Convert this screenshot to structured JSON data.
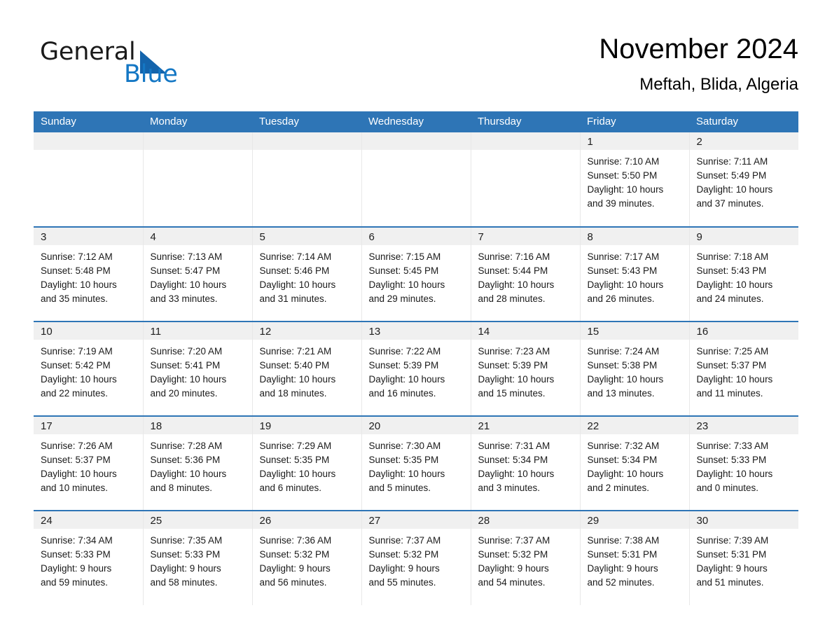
{
  "brand": {
    "line1": "General",
    "line2": "Blue",
    "triangle_color": "#1464ac",
    "blue_text_color": "#1477c4"
  },
  "header": {
    "title": "November 2024",
    "subtitle": "Meftah, Blida, Algeria"
  },
  "theme": {
    "header_blue": "#2e75b6",
    "daynum_bg": "#f0f0f0",
    "page_bg": "#ffffff"
  },
  "weekdays": [
    "Sunday",
    "Monday",
    "Tuesday",
    "Wednesday",
    "Thursday",
    "Friday",
    "Saturday"
  ],
  "weeks": [
    [
      {
        "day": "",
        "blank": true,
        "lines": [
          "",
          "",
          "",
          ""
        ]
      },
      {
        "day": "",
        "blank": true,
        "lines": [
          "",
          "",
          "",
          ""
        ]
      },
      {
        "day": "",
        "blank": true,
        "lines": [
          "",
          "",
          "",
          ""
        ]
      },
      {
        "day": "",
        "blank": true,
        "lines": [
          "",
          "",
          "",
          ""
        ]
      },
      {
        "day": "",
        "blank": true,
        "lines": [
          "",
          "",
          "",
          ""
        ]
      },
      {
        "day": "1",
        "blank": false,
        "lines": [
          "Sunrise: 7:10 AM",
          "Sunset: 5:50 PM",
          "Daylight: 10 hours",
          "and 39 minutes."
        ]
      },
      {
        "day": "2",
        "blank": false,
        "lines": [
          "Sunrise: 7:11 AM",
          "Sunset: 5:49 PM",
          "Daylight: 10 hours",
          "and 37 minutes."
        ]
      }
    ],
    [
      {
        "day": "3",
        "blank": false,
        "lines": [
          "Sunrise: 7:12 AM",
          "Sunset: 5:48 PM",
          "Daylight: 10 hours",
          "and 35 minutes."
        ]
      },
      {
        "day": "4",
        "blank": false,
        "lines": [
          "Sunrise: 7:13 AM",
          "Sunset: 5:47 PM",
          "Daylight: 10 hours",
          "and 33 minutes."
        ]
      },
      {
        "day": "5",
        "blank": false,
        "lines": [
          "Sunrise: 7:14 AM",
          "Sunset: 5:46 PM",
          "Daylight: 10 hours",
          "and 31 minutes."
        ]
      },
      {
        "day": "6",
        "blank": false,
        "lines": [
          "Sunrise: 7:15 AM",
          "Sunset: 5:45 PM",
          "Daylight: 10 hours",
          "and 29 minutes."
        ]
      },
      {
        "day": "7",
        "blank": false,
        "lines": [
          "Sunrise: 7:16 AM",
          "Sunset: 5:44 PM",
          "Daylight: 10 hours",
          "and 28 minutes."
        ]
      },
      {
        "day": "8",
        "blank": false,
        "lines": [
          "Sunrise: 7:17 AM",
          "Sunset: 5:43 PM",
          "Daylight: 10 hours",
          "and 26 minutes."
        ]
      },
      {
        "day": "9",
        "blank": false,
        "lines": [
          "Sunrise: 7:18 AM",
          "Sunset: 5:43 PM",
          "Daylight: 10 hours",
          "and 24 minutes."
        ]
      }
    ],
    [
      {
        "day": "10",
        "blank": false,
        "lines": [
          "Sunrise: 7:19 AM",
          "Sunset: 5:42 PM",
          "Daylight: 10 hours",
          "and 22 minutes."
        ]
      },
      {
        "day": "11",
        "blank": false,
        "lines": [
          "Sunrise: 7:20 AM",
          "Sunset: 5:41 PM",
          "Daylight: 10 hours",
          "and 20 minutes."
        ]
      },
      {
        "day": "12",
        "blank": false,
        "lines": [
          "Sunrise: 7:21 AM",
          "Sunset: 5:40 PM",
          "Daylight: 10 hours",
          "and 18 minutes."
        ]
      },
      {
        "day": "13",
        "blank": false,
        "lines": [
          "Sunrise: 7:22 AM",
          "Sunset: 5:39 PM",
          "Daylight: 10 hours",
          "and 16 minutes."
        ]
      },
      {
        "day": "14",
        "blank": false,
        "lines": [
          "Sunrise: 7:23 AM",
          "Sunset: 5:39 PM",
          "Daylight: 10 hours",
          "and 15 minutes."
        ]
      },
      {
        "day": "15",
        "blank": false,
        "lines": [
          "Sunrise: 7:24 AM",
          "Sunset: 5:38 PM",
          "Daylight: 10 hours",
          "and 13 minutes."
        ]
      },
      {
        "day": "16",
        "blank": false,
        "lines": [
          "Sunrise: 7:25 AM",
          "Sunset: 5:37 PM",
          "Daylight: 10 hours",
          "and 11 minutes."
        ]
      }
    ],
    [
      {
        "day": "17",
        "blank": false,
        "lines": [
          "Sunrise: 7:26 AM",
          "Sunset: 5:37 PM",
          "Daylight: 10 hours",
          "and 10 minutes."
        ]
      },
      {
        "day": "18",
        "blank": false,
        "lines": [
          "Sunrise: 7:28 AM",
          "Sunset: 5:36 PM",
          "Daylight: 10 hours",
          "and 8 minutes."
        ]
      },
      {
        "day": "19",
        "blank": false,
        "lines": [
          "Sunrise: 7:29 AM",
          "Sunset: 5:35 PM",
          "Daylight: 10 hours",
          "and 6 minutes."
        ]
      },
      {
        "day": "20",
        "blank": false,
        "lines": [
          "Sunrise: 7:30 AM",
          "Sunset: 5:35 PM",
          "Daylight: 10 hours",
          "and 5 minutes."
        ]
      },
      {
        "day": "21",
        "blank": false,
        "lines": [
          "Sunrise: 7:31 AM",
          "Sunset: 5:34 PM",
          "Daylight: 10 hours",
          "and 3 minutes."
        ]
      },
      {
        "day": "22",
        "blank": false,
        "lines": [
          "Sunrise: 7:32 AM",
          "Sunset: 5:34 PM",
          "Daylight: 10 hours",
          "and 2 minutes."
        ]
      },
      {
        "day": "23",
        "blank": false,
        "lines": [
          "Sunrise: 7:33 AM",
          "Sunset: 5:33 PM",
          "Daylight: 10 hours",
          "and 0 minutes."
        ]
      }
    ],
    [
      {
        "day": "24",
        "blank": false,
        "lines": [
          "Sunrise: 7:34 AM",
          "Sunset: 5:33 PM",
          "Daylight: 9 hours",
          "and 59 minutes."
        ]
      },
      {
        "day": "25",
        "blank": false,
        "lines": [
          "Sunrise: 7:35 AM",
          "Sunset: 5:33 PM",
          "Daylight: 9 hours",
          "and 58 minutes."
        ]
      },
      {
        "day": "26",
        "blank": false,
        "lines": [
          "Sunrise: 7:36 AM",
          "Sunset: 5:32 PM",
          "Daylight: 9 hours",
          "and 56 minutes."
        ]
      },
      {
        "day": "27",
        "blank": false,
        "lines": [
          "Sunrise: 7:37 AM",
          "Sunset: 5:32 PM",
          "Daylight: 9 hours",
          "and 55 minutes."
        ]
      },
      {
        "day": "28",
        "blank": false,
        "lines": [
          "Sunrise: 7:37 AM",
          "Sunset: 5:32 PM",
          "Daylight: 9 hours",
          "and 54 minutes."
        ]
      },
      {
        "day": "29",
        "blank": false,
        "lines": [
          "Sunrise: 7:38 AM",
          "Sunset: 5:31 PM",
          "Daylight: 9 hours",
          "and 52 minutes."
        ]
      },
      {
        "day": "30",
        "blank": false,
        "lines": [
          "Sunrise: 7:39 AM",
          "Sunset: 5:31 PM",
          "Daylight: 9 hours",
          "and 51 minutes."
        ]
      }
    ]
  ]
}
